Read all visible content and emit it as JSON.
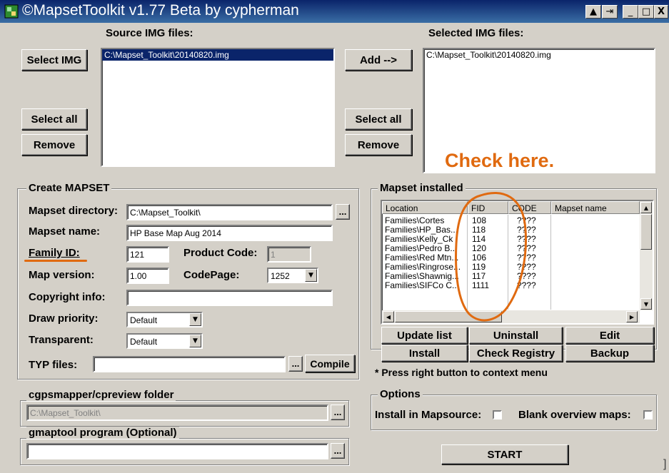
{
  "window": {
    "title": "©MapsetToolkit v1.77 Beta by cypherman",
    "ctrl_up": "▲",
    "ctrl_pin": "⇥",
    "ctrl_min": "_",
    "ctrl_max": "□",
    "ctrl_close": "X"
  },
  "source": {
    "label": "Source IMG files:",
    "files": [
      "C:\\Mapset_Toolkit\\20140820.img"
    ],
    "select_img": "Select IMG",
    "select_all": "Select all",
    "remove": "Remove"
  },
  "selected": {
    "label": "Selected IMG files:",
    "files": [
      "C:\\Mapset_Toolkit\\20140820.img"
    ],
    "add": "Add -->",
    "select_all": "Select all",
    "remove": "Remove"
  },
  "annotation": {
    "text": "Check here.",
    "color": "#e06a10"
  },
  "create": {
    "legend": "Create MAPSET",
    "dir_label": "Mapset directory:",
    "dir_value": "C:\\Mapset_Toolkit\\",
    "name_label": "Mapset name:",
    "name_value": "HP Base Map Aug 2014",
    "family_label": "Family ID:",
    "family_value": "121",
    "product_label": "Product Code:",
    "product_value": "1",
    "version_label": "Map version:",
    "version_value": "1.00",
    "codepage_label": "CodePage:",
    "codepage_value": "1252",
    "copyright_label": "Copyright info:",
    "copyright_value": "",
    "draw_label": "Draw priority:",
    "draw_value": "Default",
    "transparent_label": "Transparent:",
    "transparent_value": "Default",
    "typ_label": "TYP files:",
    "typ_value": "",
    "browse": "...",
    "compile": "Compile"
  },
  "installed": {
    "legend": "Mapset installed",
    "columns": [
      "Location",
      "FID",
      "CODE",
      "Mapset name"
    ],
    "rows": [
      {
        "location": "Families\\Cortes",
        "fid": "108",
        "code": "????"
      },
      {
        "location": "Families\\HP_Bas...",
        "fid": "118",
        "code": "????"
      },
      {
        "location": "Families\\Kelly_Ck",
        "fid": "114",
        "code": "????"
      },
      {
        "location": "Families\\Pedro B...",
        "fid": "120",
        "code": "????"
      },
      {
        "location": "Families\\Red Mtn...",
        "fid": "106",
        "code": "????"
      },
      {
        "location": "Families\\Ringrose...",
        "fid": "119",
        "code": "????"
      },
      {
        "location": "Families\\Shawnig...",
        "fid": "117",
        "code": "????"
      },
      {
        "location": "Families\\SIFCo C...",
        "fid": "1111",
        "code": "????"
      }
    ],
    "update_list": "Update list",
    "uninstall": "Uninstall",
    "edit": "Edit",
    "install": "Install",
    "check_registry": "Check Registry",
    "backup": "Backup",
    "hint": "* Press right button to context menu"
  },
  "cgps": {
    "legend": "cgpsmapper/cpreview folder",
    "value": "C:\\Mapset_Toolkit\\"
  },
  "gmaptool": {
    "legend": "gmaptool program (Optional)",
    "value": ""
  },
  "options": {
    "legend": "Options",
    "install_mapsource": "Install in Mapsource:",
    "blank_overview": "Blank overview maps:"
  },
  "start": "START"
}
